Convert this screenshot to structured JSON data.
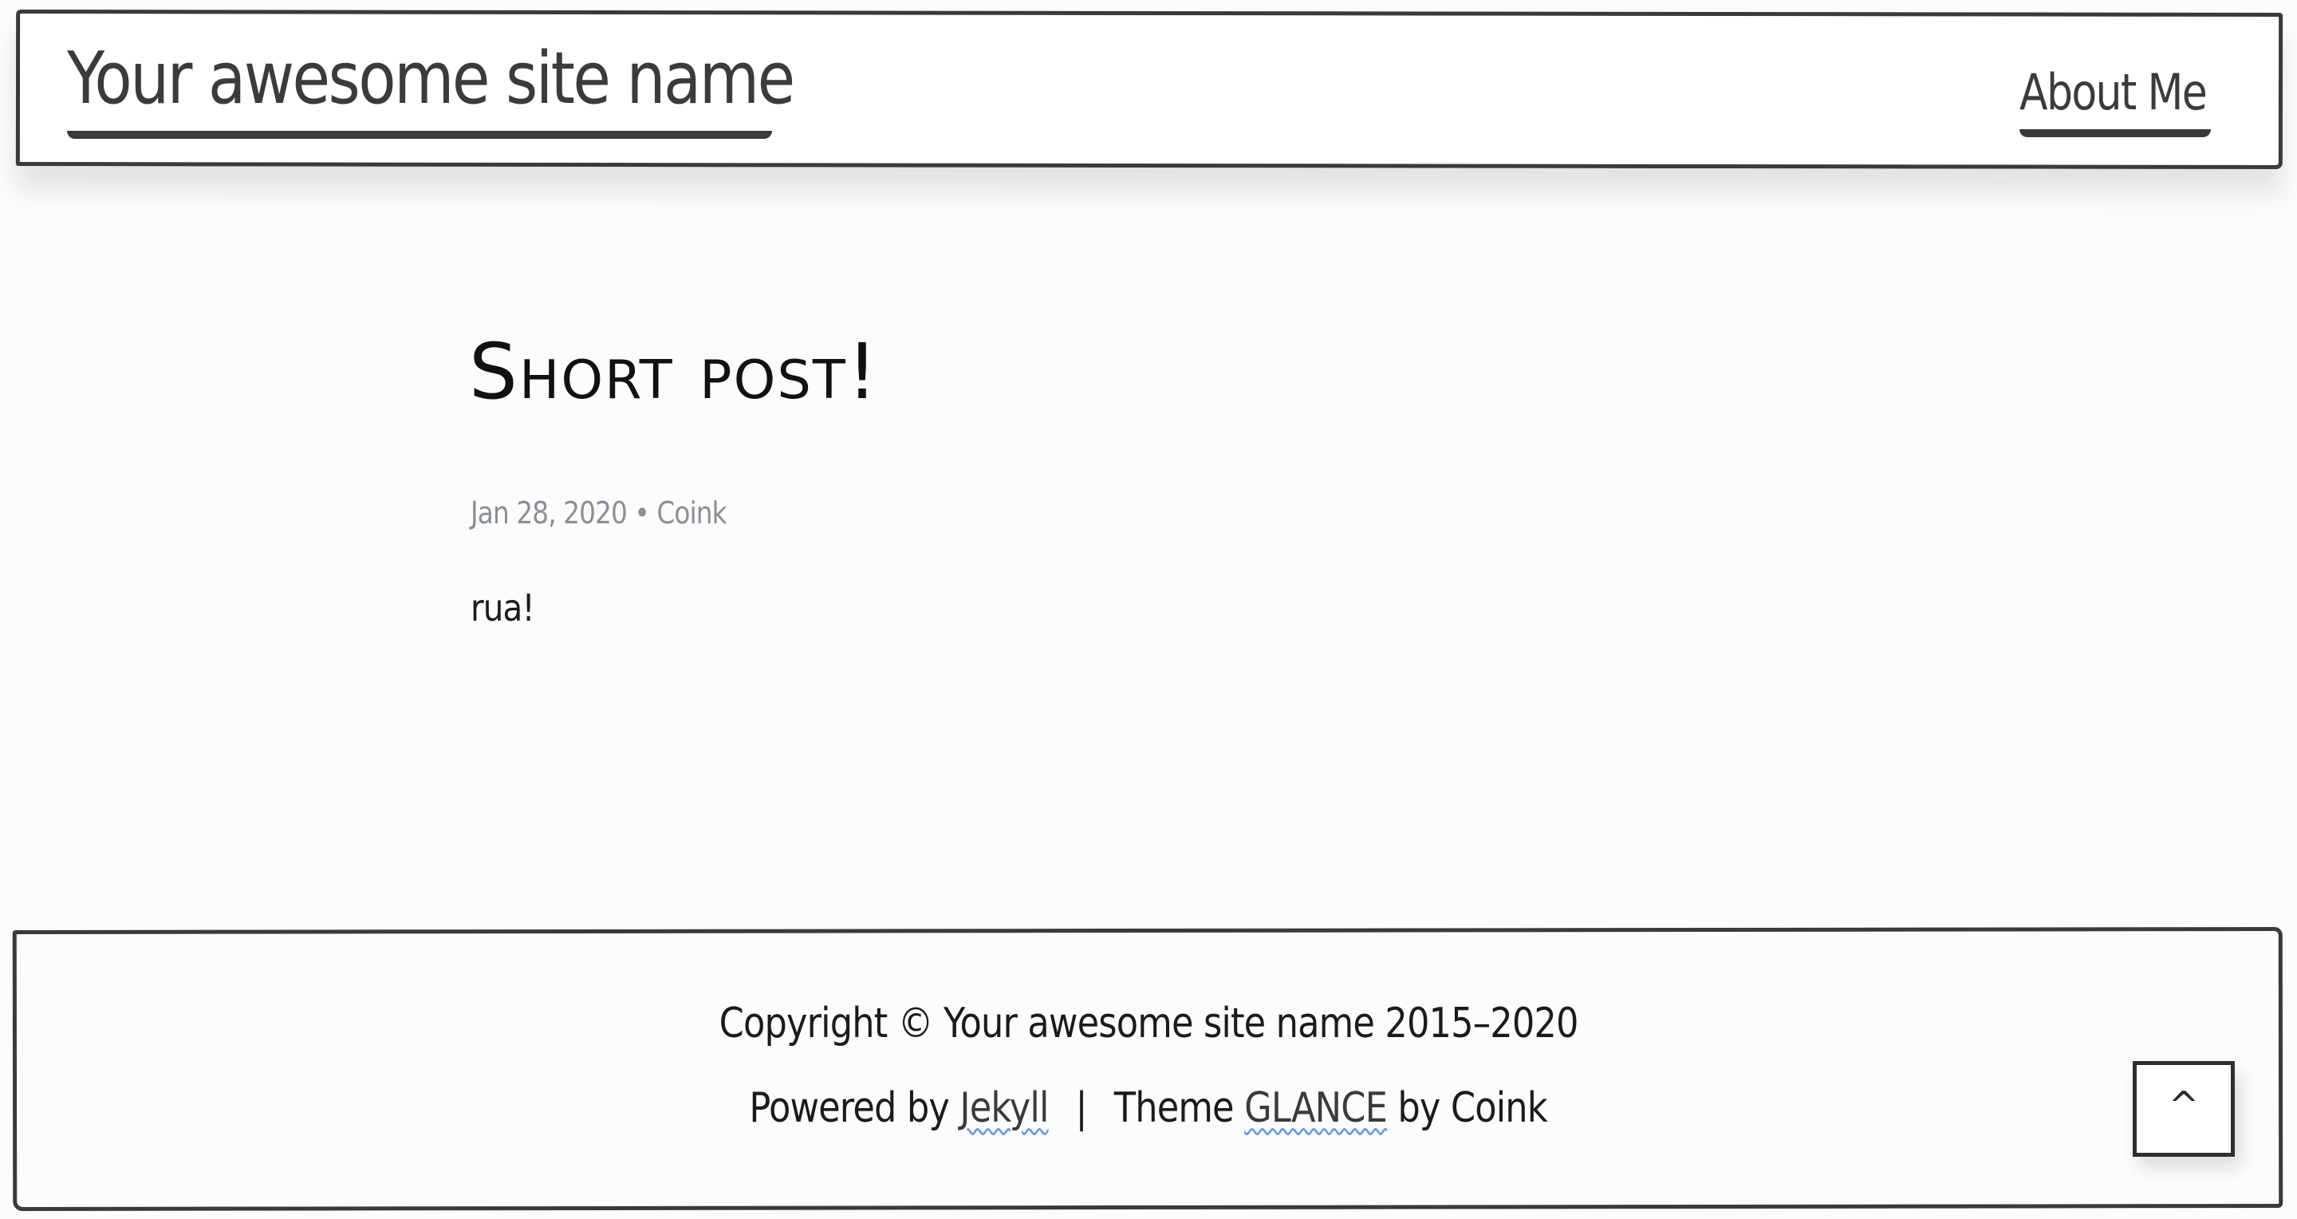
{
  "header": {
    "site_title": "Your awesome site name",
    "nav": {
      "about_label": "About Me"
    }
  },
  "post": {
    "title": "Short post!",
    "date": "Jan 28, 2020",
    "meta_separator": "•",
    "author": "Coink",
    "body": "rua!"
  },
  "footer": {
    "copyright": "Copyright © Your awesome site name 2015–2020",
    "powered_prefix": "Powered by",
    "powered_link": "Jekyll",
    "separator": "|",
    "theme_prefix": "Theme",
    "theme_link": "GLANCE",
    "theme_suffix": "by Coink",
    "back_to_top_label": "^"
  },
  "colors": {
    "border": "#3a3a3a",
    "meta_text": "#8a8f96",
    "link_underline": "#6c9de0",
    "background": "#fcfcfc"
  }
}
